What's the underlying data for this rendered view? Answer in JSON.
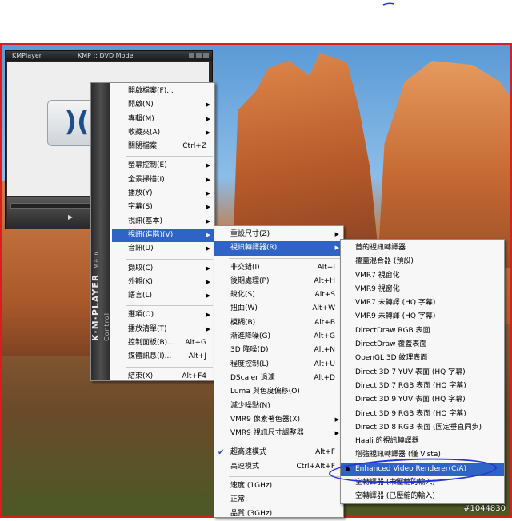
{
  "kmp_window": {
    "title_app": "KMPlayer",
    "title_mode": "KMP :: DVD Mode",
    "logo_text": ")(",
    "play_glyph": "▶|"
  },
  "main_menu": {
    "side_title": "K·M·PLAYER",
    "side_subtitle": "Main Control",
    "items": [
      {
        "label": "開啟檔案(F)...",
        "shortcut": "",
        "arrow": false
      },
      {
        "label": "開啟(N)",
        "shortcut": "",
        "arrow": true
      },
      {
        "label": "專輯(M)",
        "shortcut": "",
        "arrow": true
      },
      {
        "label": "收藏夾(A)",
        "shortcut": "",
        "arrow": true
      },
      {
        "label": "關閉檔案",
        "shortcut": "Ctrl+Z",
        "arrow": false
      },
      {
        "label": "螢幕控制(E)",
        "shortcut": "",
        "arrow": true
      },
      {
        "label": "全景掃描(I)",
        "shortcut": "",
        "arrow": true
      },
      {
        "label": "播放(Y)",
        "shortcut": "",
        "arrow": true
      },
      {
        "label": "字幕(S)",
        "shortcut": "",
        "arrow": true
      },
      {
        "label": "視訊(基本)",
        "shortcut": "",
        "arrow": true
      },
      {
        "label": "視訊(進階)(V)",
        "shortcut": "",
        "arrow": true
      },
      {
        "label": "音訊(U)",
        "shortcut": "",
        "arrow": true
      },
      {
        "label": "擷取(C)",
        "shortcut": "",
        "arrow": true
      },
      {
        "label": "外觀(K)",
        "shortcut": "",
        "arrow": true
      },
      {
        "label": "語言(L)",
        "shortcut": "",
        "arrow": true
      },
      {
        "label": "選項(O)",
        "shortcut": "",
        "arrow": true
      },
      {
        "label": "播放清單(T)",
        "shortcut": "",
        "arrow": true
      },
      {
        "label": "控制面板(B)...",
        "shortcut": "Alt+G",
        "arrow": false
      },
      {
        "label": "媒體訊息(I)...",
        "shortcut": "Alt+J",
        "arrow": false
      },
      {
        "label": "結束(X)",
        "shortcut": "Alt+F4",
        "arrow": false
      }
    ]
  },
  "video_adv_menu": {
    "items": [
      {
        "label": "重設尺寸(Z)",
        "shortcut": "",
        "arrow": true
      },
      {
        "label": "視訊轉譯器(R)",
        "shortcut": "",
        "arrow": true
      },
      {
        "label": "非交錯(I)",
        "shortcut": "Alt+I",
        "arrow": false
      },
      {
        "label": "後期處理(P)",
        "shortcut": "Alt+H",
        "arrow": false
      },
      {
        "label": "銳化(S)",
        "shortcut": "Alt+S",
        "arrow": false
      },
      {
        "label": "扭曲(W)",
        "shortcut": "Alt+W",
        "arrow": false
      },
      {
        "label": "模糊(B)",
        "shortcut": "Alt+B",
        "arrow": false
      },
      {
        "label": "漸進降噪(G)",
        "shortcut": "Alt+G",
        "arrow": false
      },
      {
        "label": "3D 降噪(D)",
        "shortcut": "Alt+N",
        "arrow": false
      },
      {
        "label": "程度控制(L)",
        "shortcut": "Alt+U",
        "arrow": false
      },
      {
        "label": "DScaler 過濾",
        "shortcut": "Alt+D",
        "arrow": false
      },
      {
        "label": "Luma 與色度偏移(O)",
        "shortcut": "",
        "arrow": false
      },
      {
        "label": "減少噪點(N)",
        "shortcut": "",
        "arrow": false
      },
      {
        "label": "VMR9 像素著色器(X)",
        "shortcut": "",
        "arrow": true
      },
      {
        "label": "VMR9 視訊尺寸調整器",
        "shortcut": "",
        "arrow": true
      },
      {
        "label": "超高速模式",
        "shortcut": "Alt+F",
        "arrow": false,
        "checked": true
      },
      {
        "label": "高速模式",
        "shortcut": "Ctrl+Alt+F",
        "arrow": false
      },
      {
        "label": "速度 (1GHz)",
        "shortcut": "",
        "arrow": false
      },
      {
        "label": "正常",
        "shortcut": "",
        "arrow": false
      },
      {
        "label": "品質 (3GHz)",
        "shortcut": "",
        "arrow": false
      }
    ]
  },
  "renderer_menu": {
    "items": [
      {
        "label": "首的視訊轉譯器"
      },
      {
        "label": "覆蓋混合器 (預設)"
      },
      {
        "label": "VMR7 視窗化"
      },
      {
        "label": "VMR9 視窗化"
      },
      {
        "label": "VMR7 未轉譯 (HQ 字幕)"
      },
      {
        "label": "VMR9 未轉譯 (HQ 字幕)"
      },
      {
        "label": "DirectDraw RGB 表面"
      },
      {
        "label": "DirectDraw 覆蓋表面"
      },
      {
        "label": "OpenGL 3D 紋理表面"
      },
      {
        "label": "Direct 3D 7 YUV 表面 (HQ 字幕)"
      },
      {
        "label": "Direct 3D 7 RGB 表面 (HQ 字幕)"
      },
      {
        "label": "Direct 3D 9 YUV 表面 (HQ 字幕)"
      },
      {
        "label": "Direct 3D 9 RGB 表面 (HQ 字幕)"
      },
      {
        "label": "Direct 3D 8 RGB 表面 (固定垂直同步)"
      },
      {
        "label": "Haali 的視訊轉譯器"
      },
      {
        "label": "增強視訊轉譯器 (僅 Vista)"
      },
      {
        "label": "Enhanced Video Renderer(C/A)",
        "selected": true
      },
      {
        "label": "空轉譯器 (未壓縮的輸入)"
      },
      {
        "label": "空轉譯器 (已壓縮的輸入)"
      }
    ]
  },
  "watermark": "#1044830",
  "colors": {
    "highlight": "#2f64c6",
    "annotation": "#2436d8",
    "frame": "#d81e1e"
  }
}
